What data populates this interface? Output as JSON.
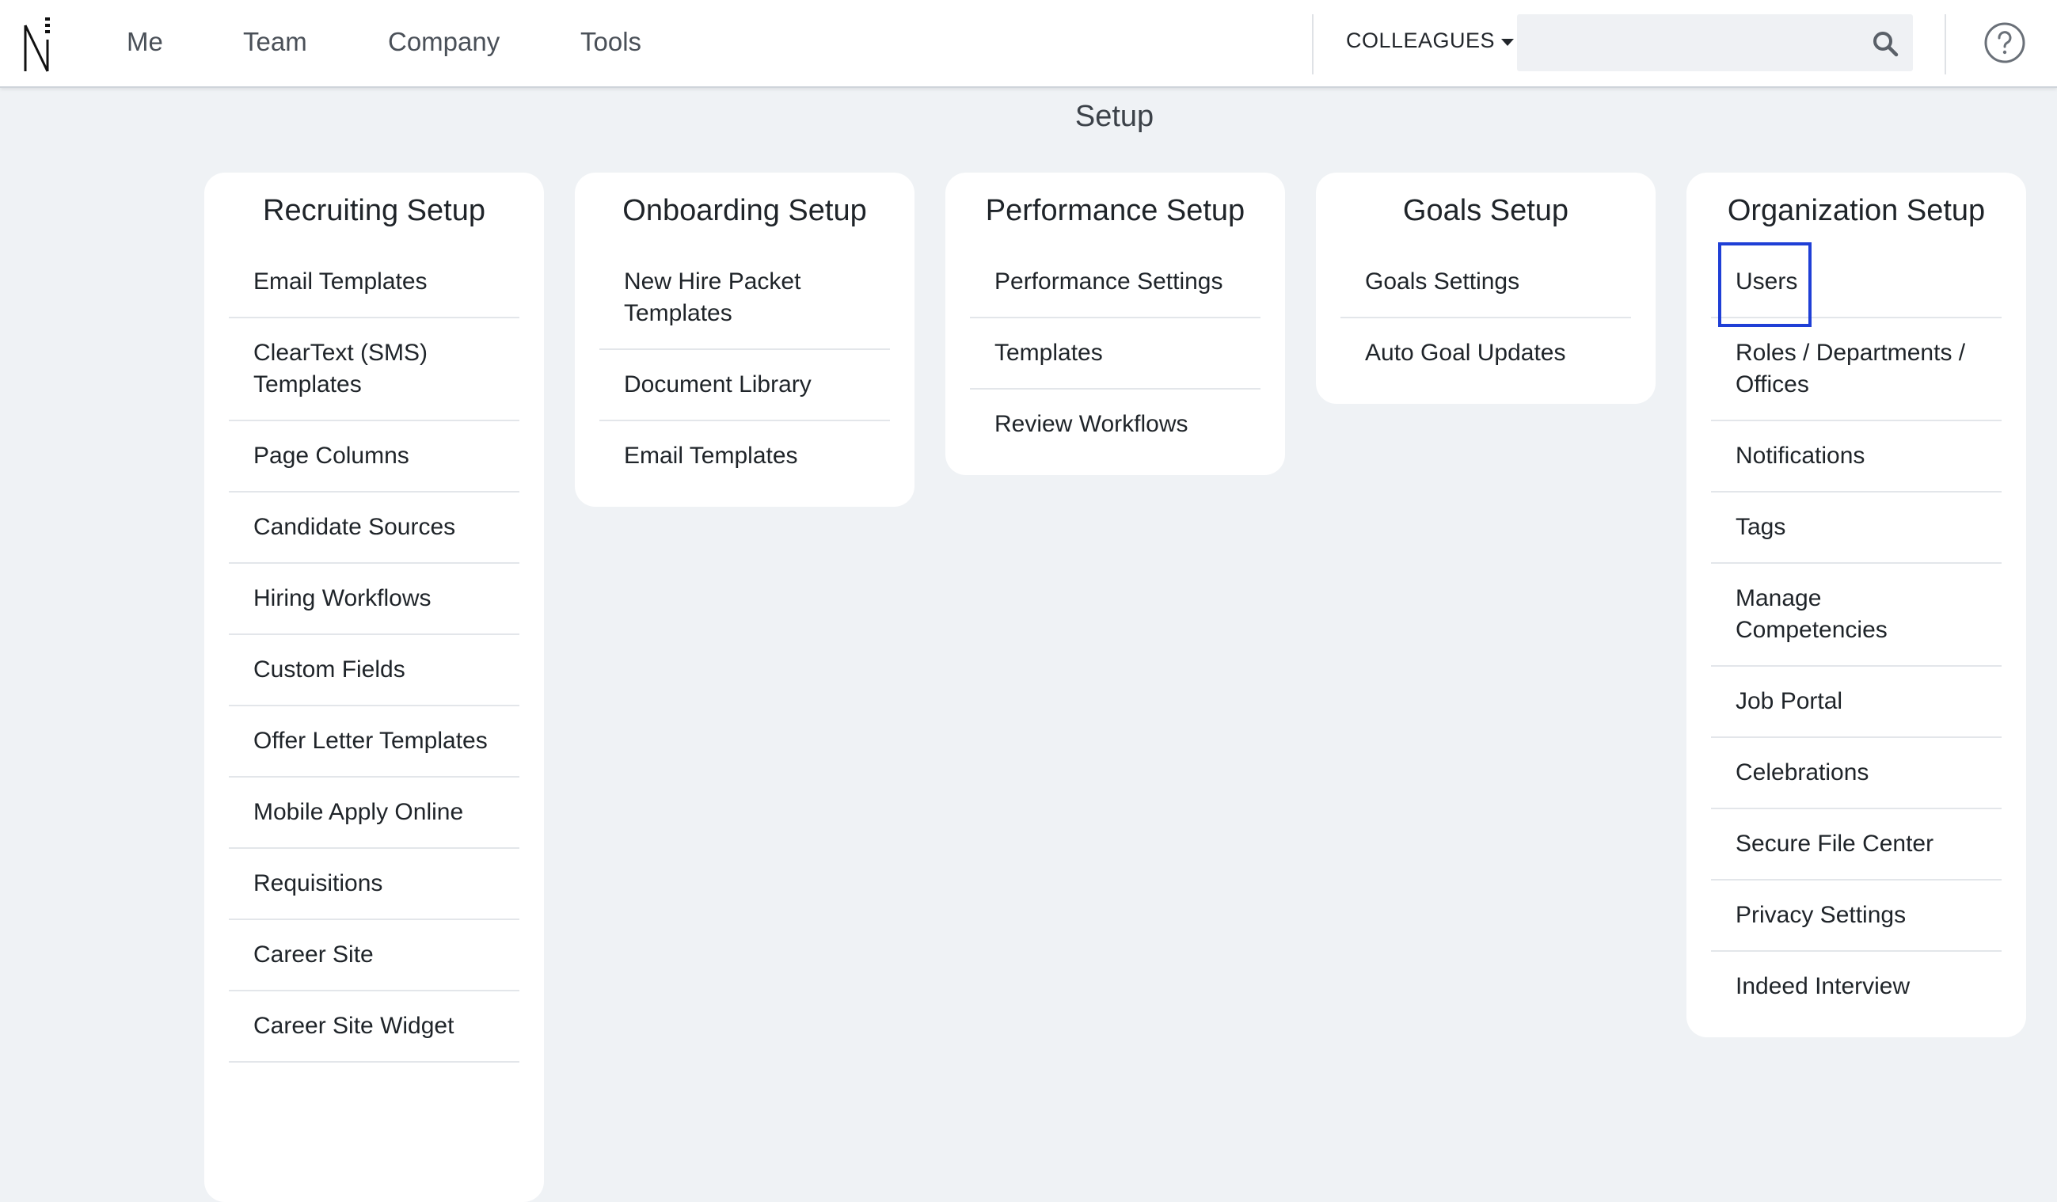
{
  "nav": {
    "items": [
      "Me",
      "Team",
      "Company",
      "Tools"
    ],
    "colleagues_label": "COLLEAGUES",
    "search_placeholder": ""
  },
  "page": {
    "title": "Setup"
  },
  "cards": [
    {
      "title": "Recruiting Setup",
      "items": [
        "Email Templates",
        "ClearText (SMS) Templates",
        "Page Columns",
        "Candidate Sources",
        "Hiring Workflows",
        "Custom Fields",
        "Offer Letter Templates",
        "Mobile Apply Online",
        "Requisitions",
        "Career Site",
        "Career Site Widget"
      ]
    },
    {
      "title": "Onboarding Setup",
      "items": [
        "New Hire Packet Templates",
        "Document Library",
        "Email Templates"
      ]
    },
    {
      "title": "Performance Setup",
      "items": [
        "Performance Settings",
        "Templates",
        "Review Workflows"
      ]
    },
    {
      "title": "Goals Setup",
      "items": [
        "Goals Settings",
        "Auto Goal Updates"
      ]
    },
    {
      "title": "Organization Setup",
      "items": [
        "Users",
        "Roles / Departments / Offices",
        "Notifications",
        "Tags",
        "Manage Competencies",
        "Job Portal",
        "Celebrations",
        "Secure File Center",
        "Privacy Settings",
        "Indeed Interview"
      ]
    }
  ],
  "colors": {
    "background": "#eff2f5",
    "card": "#ffffff",
    "highlight": "#1f3fd6"
  }
}
